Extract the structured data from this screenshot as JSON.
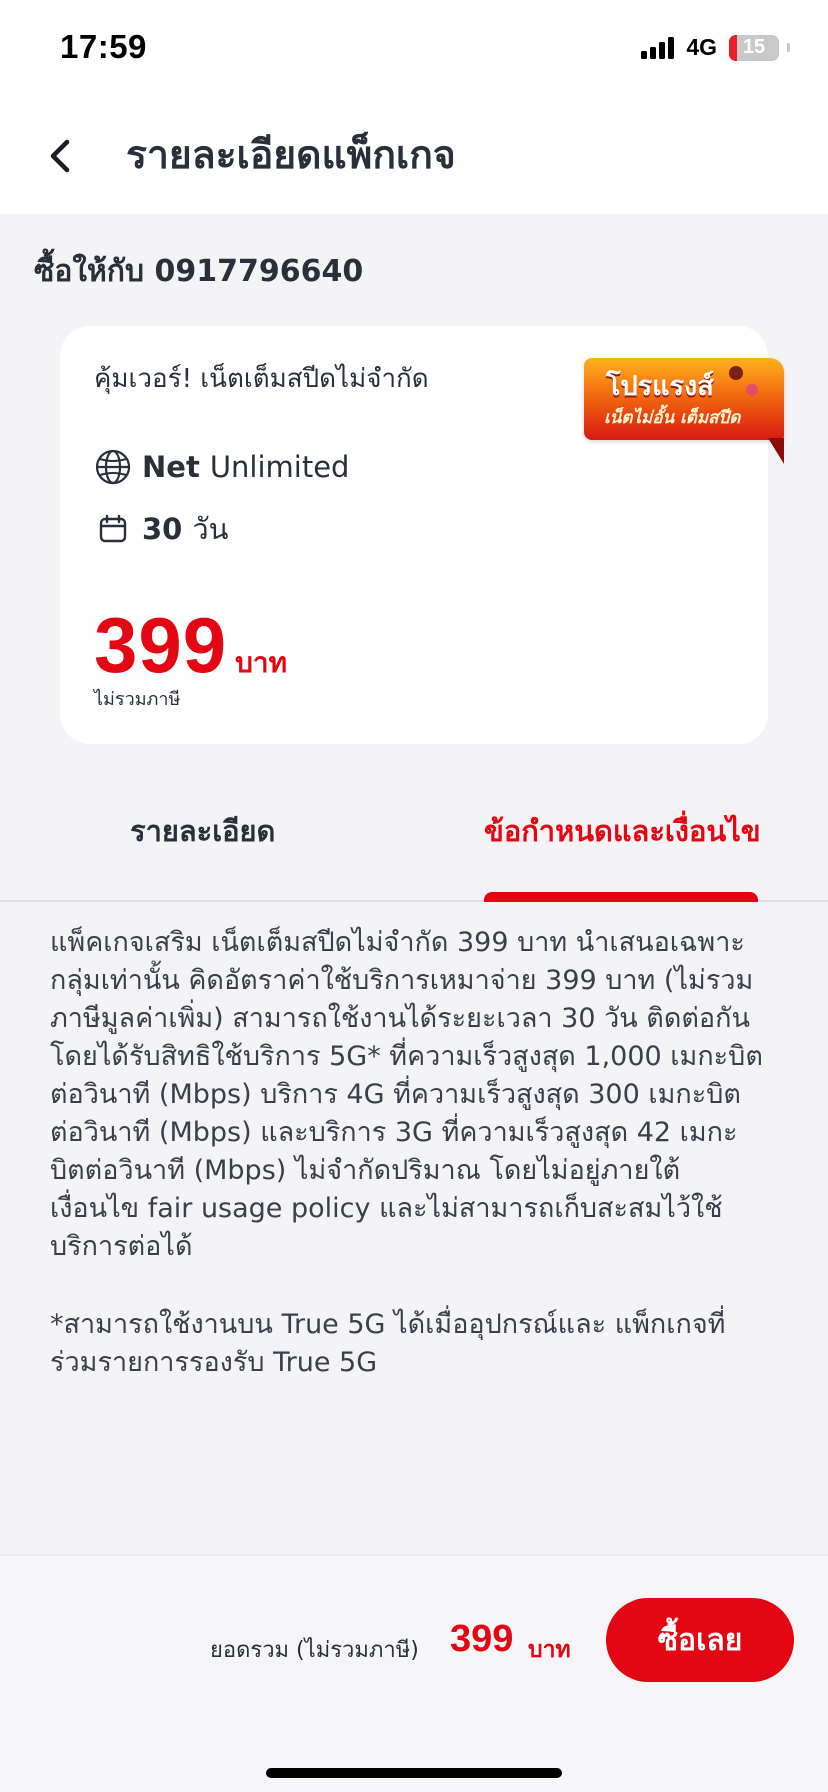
{
  "status_bar": {
    "time": "17:59",
    "network": "4G",
    "battery": "15",
    "battery_level": 0.15
  },
  "header": {
    "title": "รายละเอียดแพ็กเกจ",
    "back_icon": "chevron-left-icon"
  },
  "buy_for": "ซื้อให้กับ 0917796640",
  "package": {
    "name": "คุ้มเวอร์! เน็ตเต็มสปีดไม่จำกัด",
    "badge": {
      "line1": "โปรแรงส์",
      "line2": "เน็ตไม่อั้น เต็มสปีด"
    },
    "net_label": "Net",
    "net_value": "Unlimited",
    "days_value": "30",
    "days_unit": "วัน",
    "price": "399",
    "price_unit": "บาท",
    "price_note": "ไม่รวมภาษี"
  },
  "tabs": {
    "details": "รายละเอียด",
    "terms": "ข้อกำหนดและเงื่อนไข",
    "active": "terms"
  },
  "content": {
    "body": "แพ็คเกจเสริม เน็ตเต็มสปีดไม่จำกัด 399 บาท นำเสนอเฉพาะ\nกลุ่มเท่านั้น คิดอัตราค่าใช้บริการเหมาจ่าย 399 บาท (ไม่รวม\nภาษีมูลค่าเพิ่ม) สามารถใช้งานได้ระยะเวลา 30 วัน ติดต่อกัน\nโดยได้รับสิทธิใช้บริการ 5G* ที่ความเร็วสูงสุด 1,000 เมกะบิต\nต่อวินาที (Mbps) บริการ 4G ที่ความเร็วสูงสุด 300 เมกะบิต\nต่อวินาที (Mbps) และบริการ 3G ที่ความเร็วสูงสุด 42 เมกะ\nบิตต่อวินาที (Mbps) ไม่จำกัดปริมาณ โดยไม่อยู่ภายใต้\nเงื่อนไข fair usage policy และไม่สามารถเก็บสะสมไว้ใช้\nบริการต่อได้",
    "note": "*สามารถใช้งานบน True 5G ได้เมื่ออุปกรณ์และ แพ็กเกจที่\nร่วมรายการรองรับ True 5G"
  },
  "footer": {
    "total_label": "ยอดรวม (ไม่รวมภาษี)",
    "total_price": "399",
    "total_unit": "บาท",
    "buy_button": "ซื้อเลย"
  },
  "colors": {
    "accent": "#e30613",
    "text": "#2a2f3a",
    "background": "#f4f4f7",
    "card": "#ffffff"
  }
}
